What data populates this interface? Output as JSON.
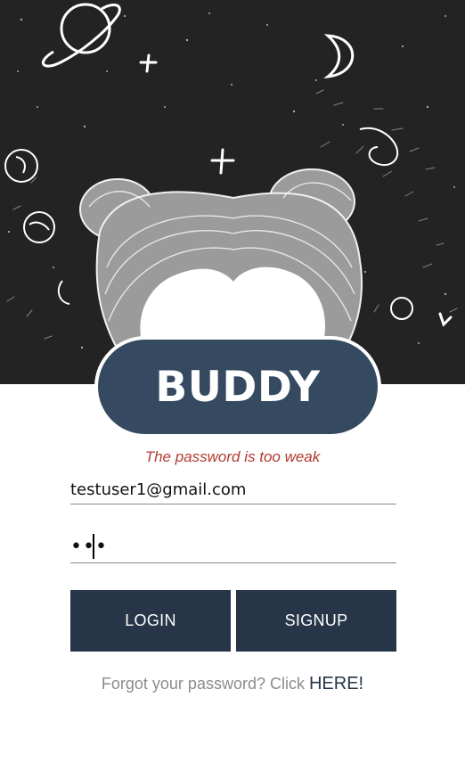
{
  "brand": {
    "title": "BUDDY"
  },
  "form": {
    "error": "The password is too weak",
    "email_value": "testuser1@gmail.com",
    "password_value": "•••"
  },
  "buttons": {
    "login": "LOGIN",
    "signup": "SIGNUP"
  },
  "footer": {
    "forgot_prefix": "Forgot your password? Click ",
    "forgot_link": "HERE!"
  },
  "colors": {
    "header_bg": "#232323",
    "brand_pill": "#354a61",
    "button_bg": "#263548",
    "error_text": "#b33a32",
    "muted_text": "#8c8c8c"
  },
  "icons": {
    "hero": "illustrated-girl-space-sky"
  }
}
